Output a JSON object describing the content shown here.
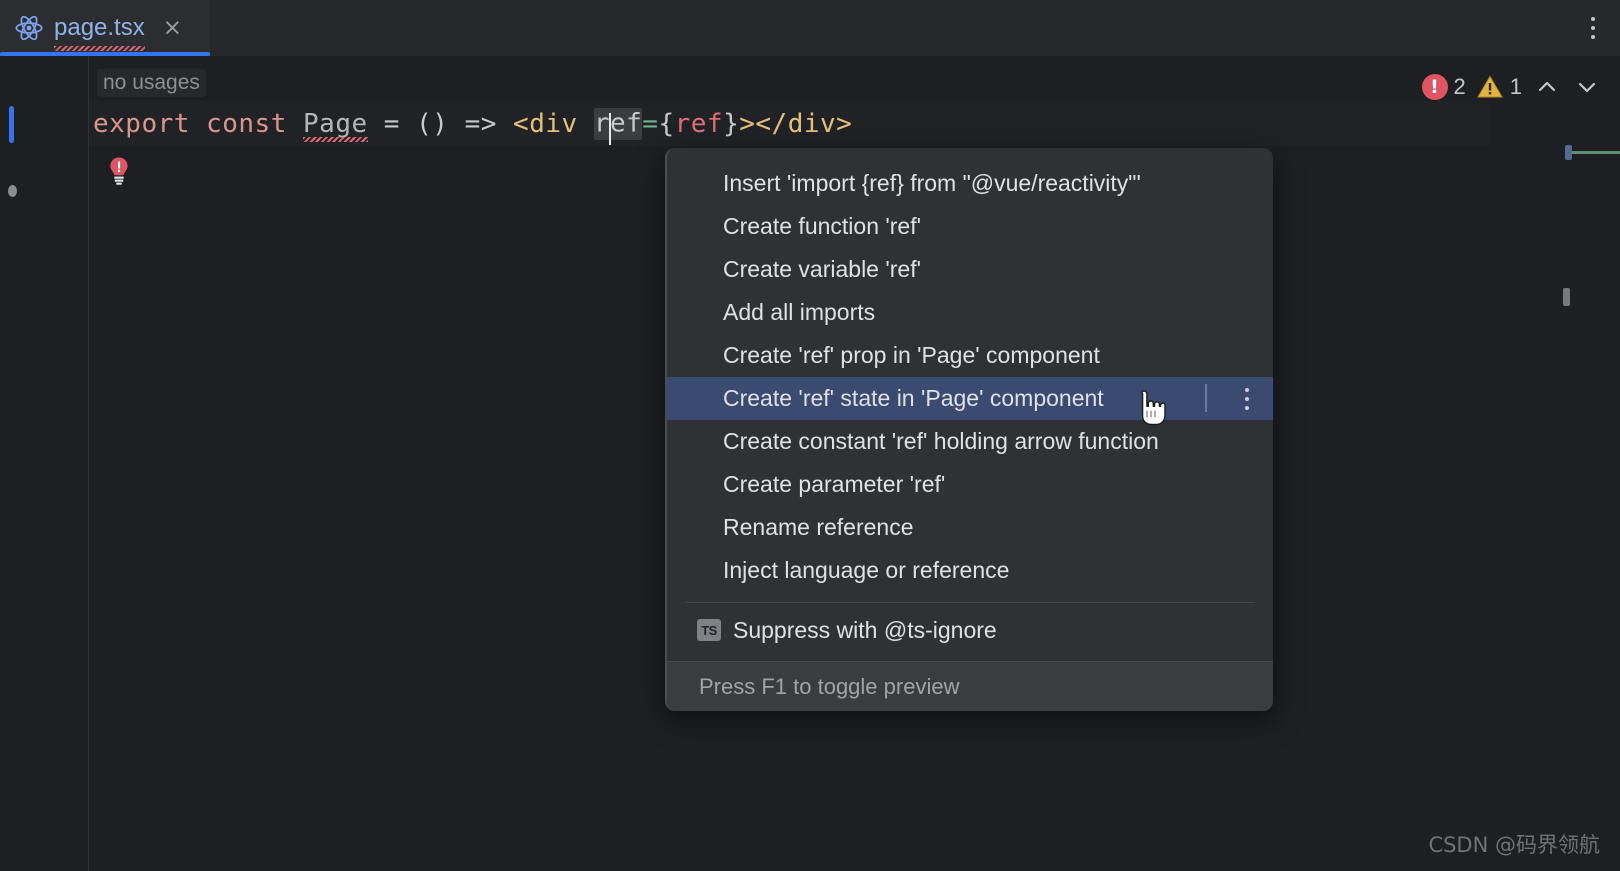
{
  "tab": {
    "icon": "react-icon",
    "title": "page.tsx",
    "close_label": "×"
  },
  "window": {
    "kebab_label": "more-options"
  },
  "editor": {
    "inlay_hint": "no usages",
    "bulb_icon": "quick-fix-bulb-icon",
    "code": {
      "kw_export": "export",
      "kw_const": "const",
      "fn_name": "Page",
      "eq1": " = ",
      "parens": "()",
      "arrow": " => ",
      "tag_open": "<div",
      "space": " ",
      "attr_left": "r",
      "attr_right": "ef",
      "attr_eq": "=",
      "brace_open": "{",
      "ref_err": "ref",
      "brace_close": "}",
      "tag_close_open": ">",
      "tag_close": "</div>"
    }
  },
  "status": {
    "error_icon": "error-icon",
    "error_count": "2",
    "warning_icon": "warning-icon",
    "warning_count": "1",
    "prev_icon": "chevron-up-icon",
    "next_icon": "chevron-down-icon"
  },
  "popup": {
    "items": [
      {
        "label": "Insert 'import {ref} from \"@vue/reactivity\"'",
        "selected": false
      },
      {
        "label": "Create function 'ref'",
        "selected": false
      },
      {
        "label": "Create variable 'ref'",
        "selected": false
      },
      {
        "label": "Add all imports",
        "selected": false
      },
      {
        "label": "Create 'ref' prop in 'Page' component",
        "selected": false
      },
      {
        "label": "Create 'ref' state in 'Page' component",
        "selected": true
      },
      {
        "label": "Create constant 'ref' holding arrow function",
        "selected": false
      },
      {
        "label": "Create parameter 'ref'",
        "selected": false
      },
      {
        "label": "Rename reference",
        "selected": false
      },
      {
        "label": "Inject language or reference",
        "selected": false
      }
    ],
    "suppress": {
      "badge": "TS",
      "label": "Suppress with @ts-ignore"
    },
    "footer": "Press F1 to toggle preview"
  },
  "watermark": "CSDN @码界领航",
  "colors": {
    "accent_blue": "#3574f0",
    "selection_blue": "#3a4a71",
    "error_red": "#e05563",
    "warning_yellow": "#e3b341",
    "tab_title_blue": "#8fb3e8",
    "editor_bg": "#1e1f22",
    "popup_bg": "#2f3134"
  }
}
